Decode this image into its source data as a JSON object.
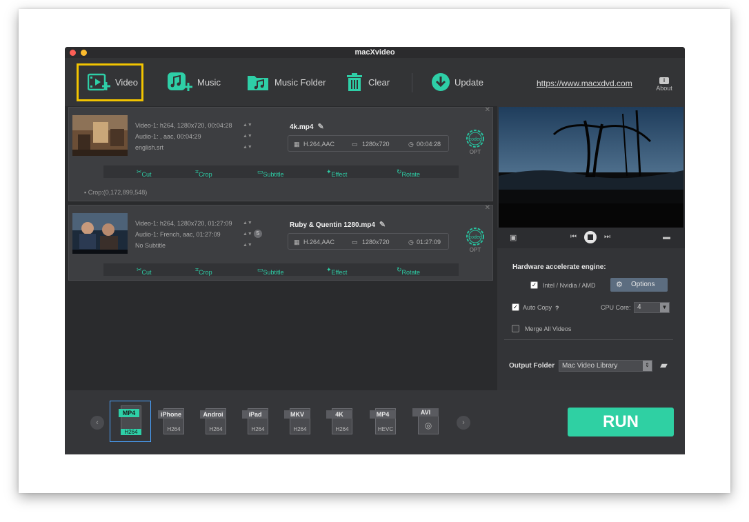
{
  "window": {
    "title": "macXvideo"
  },
  "toolbar": {
    "video_label": "Video",
    "music_label": "Music",
    "music_folder_label": "Music Folder",
    "clear_label": "Clear",
    "update_label": "Update",
    "website_link": "https://www.macxdvd.com",
    "about_label": "About"
  },
  "items": [
    {
      "video_info": "Video-1: h264, 1280x720, 00:04:28",
      "audio_info": "Audio-1: , aac, 00:04:29",
      "subtitle_info": "english.srt",
      "output_name": "4k.mp4",
      "codec_info": "H.264,AAC",
      "resolution": "1280x720",
      "duration": "00:04:28",
      "crop_note": "Crop:(0,172,899,548)"
    },
    {
      "video_info": "Video-1: h264, 1280x720, 01:27:09",
      "audio_info": "Audio-1: French, aac, 01:27:09",
      "subtitle_info": "No Subtitle",
      "badge": "5",
      "output_name": "Ruby & Quentin 1280.mp4",
      "codec_info": "H.264,AAC",
      "resolution": "1280x720",
      "duration": "01:27:09"
    }
  ],
  "edit_actions": {
    "cut": "Cut",
    "crop": "Crop",
    "subtitle": "Subtitle",
    "effect": "Effect",
    "rotate": "Rotate"
  },
  "codec_button": {
    "top": "codec",
    "bottom": "OPT"
  },
  "settings": {
    "hw_title": "Hardware accelerate engine:",
    "hw_option": "Intel / Nvidia / AMD",
    "options_button": "Options",
    "auto_copy": "Auto Copy",
    "help_mark": "?",
    "cpu_core_label": "CPU Core:",
    "cpu_core_value": "4",
    "merge_label": "Merge All Videos",
    "output_folder_label": "Output Folder",
    "output_folder_value": "Mac Video Library"
  },
  "formats": [
    {
      "tag": "MP4",
      "sub": "H264",
      "selected": true
    },
    {
      "tag": "iPhone",
      "sub": "H264"
    },
    {
      "tag": "Androi",
      "sub": "H264"
    },
    {
      "tag": "iPad",
      "sub": "H264"
    },
    {
      "tag": "MKV",
      "sub": "H264"
    },
    {
      "tag": "4K",
      "sub": "H264"
    },
    {
      "tag": "MP4",
      "sub": "HEVC"
    },
    {
      "tag": "AVI",
      "sub": ""
    }
  ],
  "run_label": "RUN",
  "colors": {
    "accent": "#2fd0a3",
    "highlight": "#f2c400"
  }
}
